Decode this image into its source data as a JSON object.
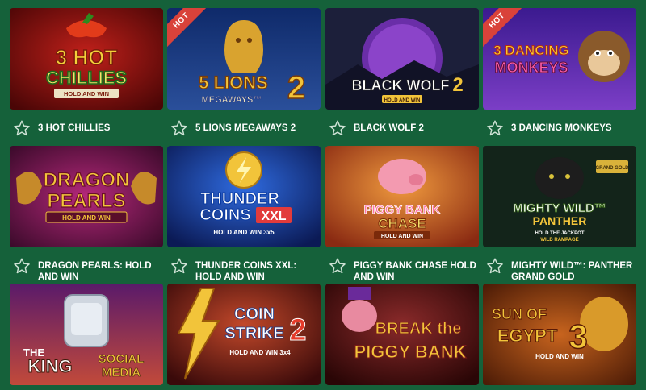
{
  "games": [
    {
      "title": "3 HOT CHILLIES",
      "hot": false,
      "logo": "3 HOT CHILLIES",
      "subtitle": "HOLD AND WIN",
      "theme": "chili"
    },
    {
      "title": "5 LIONS MEGAWAYS 2",
      "hot": true,
      "logo": "5 LIONS MEGAWAYS 2",
      "subtitle": "",
      "theme": "lions"
    },
    {
      "title": "BLACK WOLF 2",
      "hot": false,
      "logo": "BLACK WOLF 2",
      "subtitle": "HOLD AND WIN",
      "theme": "wolf"
    },
    {
      "title": "3 DANCING MONKEYS",
      "hot": true,
      "logo": "3 DANCING MONKEYS",
      "subtitle": "",
      "theme": "monkeys"
    },
    {
      "title": "DRAGON PEARLS: HOLD AND WIN",
      "hot": false,
      "logo": "DRAGON PEARLS",
      "subtitle": "HOLD AND WIN",
      "theme": "dragon"
    },
    {
      "title": "THUNDER COINS XXL: HOLD AND WIN",
      "hot": false,
      "logo": "THUNDER COINS XXL",
      "subtitle": "HOLD AND WIN 3x5",
      "theme": "thunder"
    },
    {
      "title": "PIGGY BANK CHASE HOLD AND WIN",
      "hot": false,
      "logo": "PIGGY BANK CHASE",
      "subtitle": "HOLD AND WIN",
      "theme": "piggy"
    },
    {
      "title": "MIGHTY WILD™: PANTHER GRAND GOLD",
      "hot": false,
      "logo": "MIGHTY WILD™ PANTHER",
      "subtitle": "HOLD THE JACKPOT WILD RAMPAGE",
      "theme": "panther"
    },
    {
      "title": "",
      "hot": false,
      "logo": "THE KING OF SOCIAL MEDIA",
      "subtitle": "",
      "theme": "king"
    },
    {
      "title": "",
      "hot": false,
      "logo": "COIN STRIKE 2",
      "subtitle": "HOLD AND WIN 3x4",
      "theme": "coin"
    },
    {
      "title": "",
      "hot": false,
      "logo": "BREAK THE PIGGY BANK",
      "subtitle": "",
      "theme": "break"
    },
    {
      "title": "",
      "hot": false,
      "logo": "SUN OF EGYPT 3",
      "subtitle": "HOLD AND WIN",
      "theme": "egypt"
    }
  ],
  "hot_label": "HOT",
  "colors": {
    "background": "#15613a",
    "hot_badge": "#d9423a",
    "text": "#ffffff"
  },
  "icons": {
    "favorite": "star-outline-icon"
  }
}
